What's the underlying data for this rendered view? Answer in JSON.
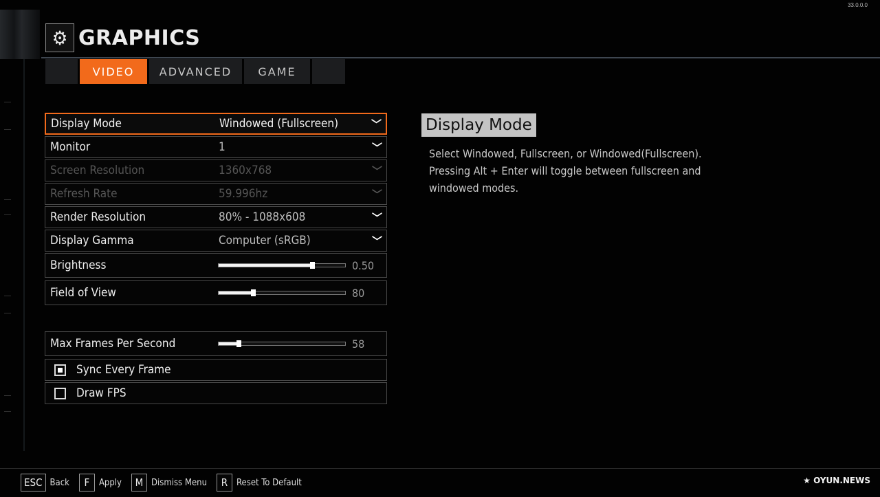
{
  "version": "33.0.0.0",
  "header": {
    "title": "GRAPHICS",
    "icon": "gears-icon"
  },
  "tabs": [
    {
      "label": "VIDEO",
      "active": true
    },
    {
      "label": "ADVANCED",
      "active": false
    },
    {
      "label": "GAME",
      "active": false
    }
  ],
  "settings": {
    "display_mode": {
      "label": "Display Mode",
      "value": "Windowed (Fullscreen)"
    },
    "monitor": {
      "label": "Monitor",
      "value": "1"
    },
    "screen_resolution": {
      "label": "Screen Resolution",
      "value": "1360x768",
      "disabled": true
    },
    "refresh_rate": {
      "label": "Refresh Rate",
      "value": "59.996hz",
      "disabled": true
    },
    "render_resolution": {
      "label": "Render Resolution",
      "value": "80% - 1088x608"
    },
    "display_gamma": {
      "label": "Display Gamma",
      "value": "Computer (sRGB)"
    },
    "brightness": {
      "label": "Brightness",
      "value": "0.50",
      "fill_fraction": 0.74
    },
    "field_of_view": {
      "label": "Field of View",
      "value": "80",
      "fill_fraction": 0.27
    },
    "max_fps": {
      "label": "Max Frames Per Second",
      "value": "58",
      "fill_fraction": 0.16
    },
    "sync_every_frame": {
      "label": "Sync Every Frame",
      "checked": true
    },
    "draw_fps": {
      "label": "Draw FPS",
      "checked": false
    }
  },
  "description": {
    "title": "Display Mode",
    "text": "Select Windowed, Fullscreen, or Windowed(Fullscreen). Pressing Alt + Enter will toggle between fullscreen and windowed modes."
  },
  "footer": {
    "hints": [
      {
        "key": "ESC",
        "label": "Back"
      },
      {
        "key": "F",
        "label": "Apply"
      },
      {
        "key": "M",
        "label": "Dismiss Menu"
      },
      {
        "key": "R",
        "label": "Reset To Default"
      }
    ],
    "brand": "OYUN.NEWS"
  },
  "colors": {
    "accent": "#f26a1b",
    "background": "#020202",
    "row_border": "#4a4a4a"
  }
}
